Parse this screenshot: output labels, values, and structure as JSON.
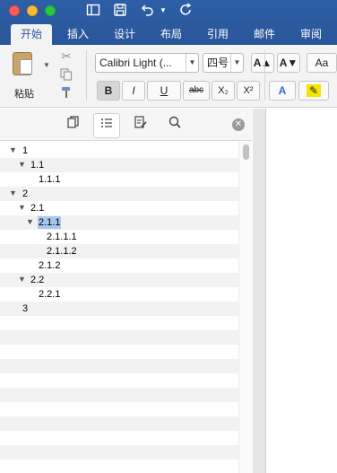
{
  "window": {
    "qat_icons": [
      "sidebar-icon",
      "save-icon",
      "undo-icon",
      "dropdown-icon",
      "redo-icon"
    ]
  },
  "ribbon_tabs": [
    {
      "label": "开始",
      "active": true
    },
    {
      "label": "插入",
      "active": false
    },
    {
      "label": "设计",
      "active": false
    },
    {
      "label": "布局",
      "active": false
    },
    {
      "label": "引用",
      "active": false
    },
    {
      "label": "邮件",
      "active": false
    },
    {
      "label": "审阅",
      "active": false
    }
  ],
  "ribbon": {
    "paste_label": "粘贴",
    "font_name": "Calibri Light (...",
    "font_size": "四号",
    "grow_font": "A▲",
    "shrink_font": "A▼",
    "change_case": "Aa",
    "bold": "B",
    "italic": "I",
    "underline": "U",
    "strikethrough": "abc",
    "subscript": "X₂",
    "superscript": "X²",
    "text_effects": "A",
    "highlight": "✎"
  },
  "nav_pane": {
    "views": [
      "thumbnails-view-icon",
      "headings-view-icon",
      "edit-view-icon",
      "search-icon"
    ],
    "active_view": "headings-view-icon",
    "headings": [
      {
        "text": "1",
        "expanded": true
      },
      {
        "text": "1.1",
        "expanded": true
      },
      {
        "text": "1.1.1",
        "expanded": false
      },
      {
        "text": "2",
        "expanded": true
      },
      {
        "text": "2.1",
        "expanded": true
      },
      {
        "text": "2.1.1",
        "expanded": true,
        "selected": true
      },
      {
        "text": "2.1.1.1",
        "expanded": false
      },
      {
        "text": "2.1.1.2",
        "expanded": false
      },
      {
        "text": "2.1.2",
        "expanded": false
      },
      {
        "text": "2.2",
        "expanded": true
      },
      {
        "text": "2.2.1",
        "expanded": false
      },
      {
        "text": "3",
        "expanded": false
      }
    ]
  },
  "colors": {
    "ribbon_blue": "#2b579a",
    "selection": "#a8c7ee"
  }
}
